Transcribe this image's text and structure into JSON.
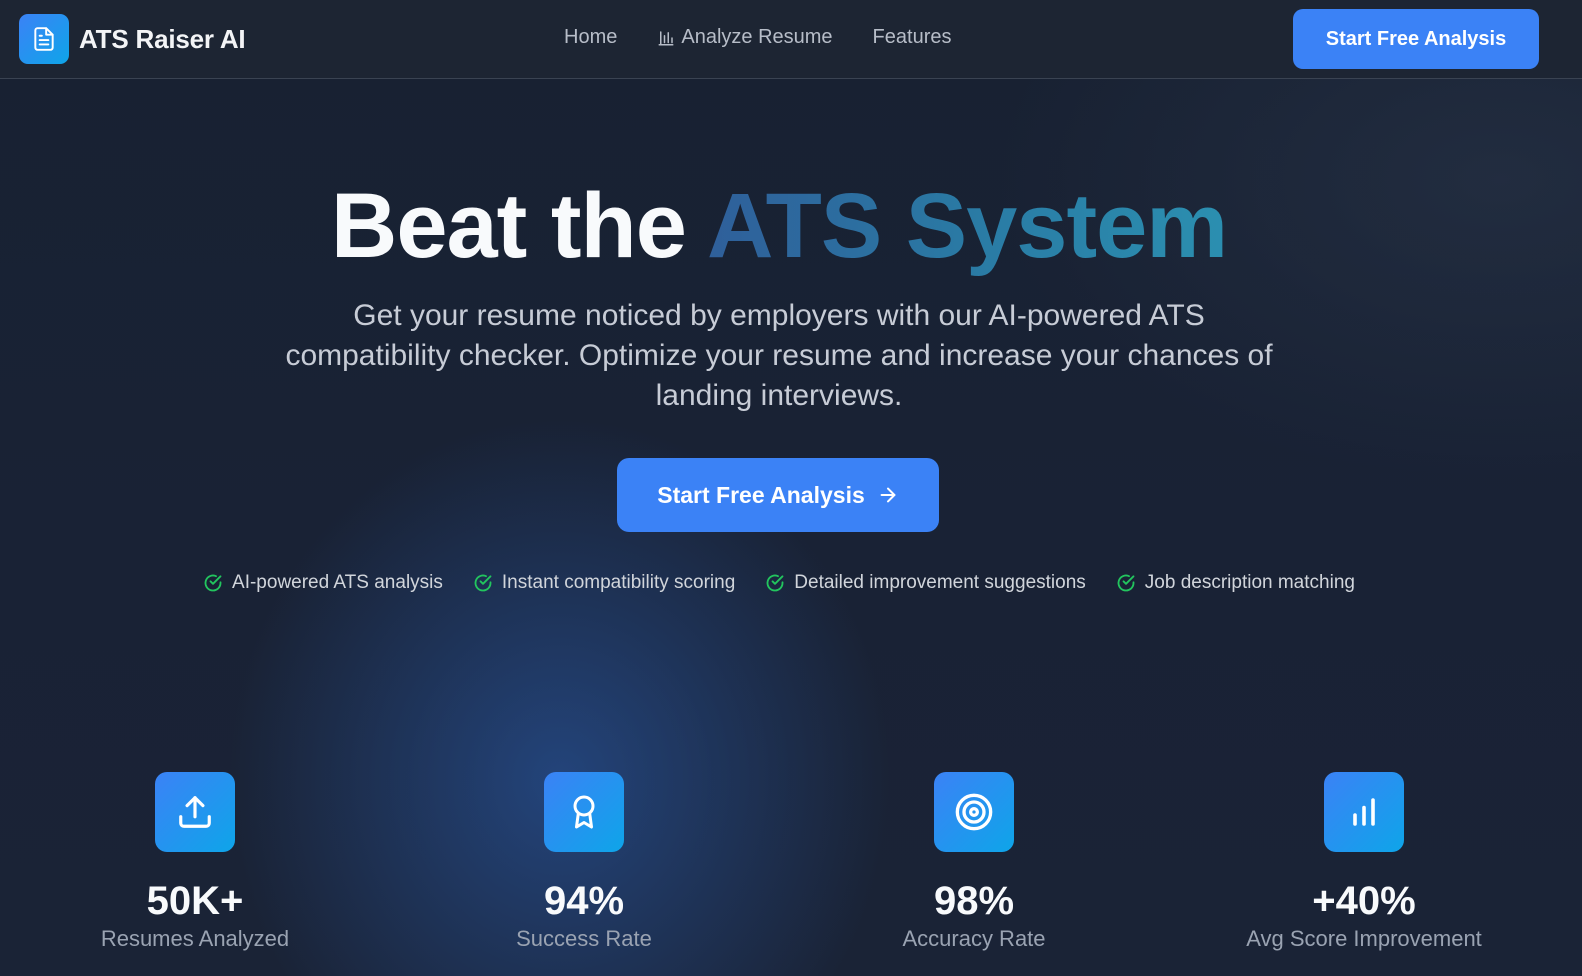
{
  "nav": {
    "brand": "ATS Raiser AI",
    "links": [
      {
        "label": "Home",
        "icon": ""
      },
      {
        "label": "Analyze Resume",
        "icon": "bar-chart-icon"
      },
      {
        "label": "Features",
        "icon": ""
      }
    ],
    "cta_label": "Start Free Analysis"
  },
  "hero": {
    "title_plain": "Beat the ",
    "title_accent": "ATS System",
    "subtitle": "Get your resume noticed by employers with our AI-powered ATS compatibility checker. Optimize your resume and increase your chances of landing interviews.",
    "cta_label": "Start Free Analysis",
    "features": [
      "AI-powered ATS analysis",
      "Instant compatibility scoring",
      "Detailed improvement suggestions",
      "Job description matching"
    ]
  },
  "stats": [
    {
      "value": "50K+",
      "label": "Resumes Analyzed",
      "icon": "upload-icon"
    },
    {
      "value": "94%",
      "label": "Success Rate",
      "icon": "award-icon"
    },
    {
      "value": "98%",
      "label": "Accuracy Rate",
      "icon": "target-icon"
    },
    {
      "value": "+40%",
      "label": "Avg Score Improvement",
      "icon": "bar-chart-icon"
    }
  ],
  "colors": {
    "primary": "#3b82f6",
    "accent": "#0ea5e9",
    "check": "#22c55e",
    "background": "#18202e"
  }
}
